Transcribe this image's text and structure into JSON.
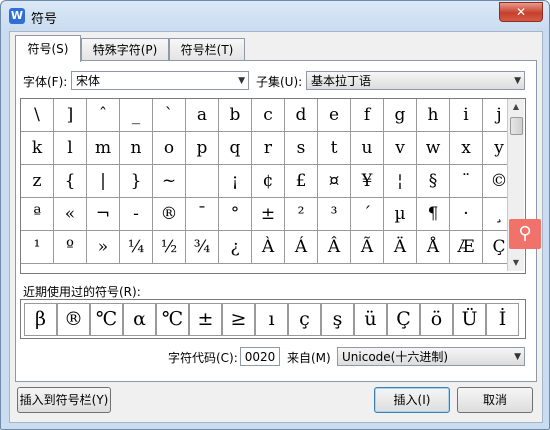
{
  "window": {
    "title": "符号",
    "app_icon_letter": "W",
    "close_glyph": "✕"
  },
  "tabs": [
    {
      "label": "符号(S)",
      "active": true
    },
    {
      "label": "特殊字符(P)",
      "active": false
    },
    {
      "label": "符号栏(T)",
      "active": false
    }
  ],
  "font": {
    "label": "字体(F):",
    "value": "宋体"
  },
  "subset": {
    "label": "子集(U):",
    "value": "基本拉丁语"
  },
  "symbol_grid": {
    "rows": [
      [
        "\\",
        "]",
        "ˆ",
        "_",
        "`",
        "a",
        "b",
        "c",
        "d",
        "e",
        "f",
        "g",
        "h",
        "i",
        "j"
      ],
      [
        "k",
        "l",
        "m",
        "n",
        "o",
        "p",
        "q",
        "r",
        "s",
        "t",
        "u",
        "v",
        "w",
        "x",
        "y"
      ],
      [
        "z",
        "{",
        "|",
        "}",
        "~",
        "",
        "¡",
        "¢",
        "£",
        "¤",
        "¥",
        "¦",
        "§",
        "¨",
        "©"
      ],
      [
        "ª",
        "«",
        "¬",
        "-",
        "®",
        "¯",
        "°",
        "±",
        "²",
        "³",
        "´",
        "µ",
        "¶",
        "·",
        "¸"
      ],
      [
        "¹",
        "º",
        "»",
        "¼",
        "½",
        "¾",
        "¿",
        "À",
        "Á",
        "Â",
        "Ã",
        "Ä",
        "Å",
        "Æ",
        "Ç"
      ]
    ],
    "scroll_up": "▲",
    "scroll_down": "▼"
  },
  "recent": {
    "label": "近期使用过的符号(R):",
    "symbols": [
      "β",
      "®",
      "℃",
      "α",
      "℃",
      "±",
      "≥",
      "ı",
      "ç",
      "ş",
      "ü",
      "Ç",
      "ö",
      "Ü",
      "İ"
    ]
  },
  "char_code": {
    "label": "字符代码(C):",
    "value": "0020"
  },
  "from": {
    "label": "来自(M)",
    "value": "Unicode(十六进制)"
  },
  "buttons": {
    "insert_to_bar": "插入到符号栏(Y)",
    "insert": "插入(I)",
    "cancel": "取消"
  },
  "overlay": {
    "search_glyph": "⚲"
  }
}
